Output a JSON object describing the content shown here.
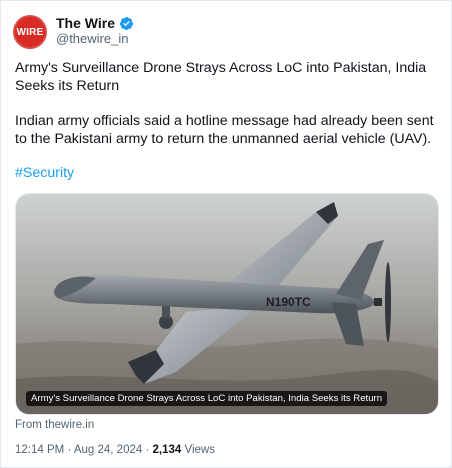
{
  "account": {
    "avatar_text": "WIRE",
    "name": "The Wire",
    "handle": "@thewire_in",
    "brand_color": "#d82b25",
    "verified_color": "#1d9bf0"
  },
  "tweet": {
    "title": "Army's Surveillance Drone Strays Across LoC into Pakistan, India Seeks its Return",
    "body": "Indian army officials said a hotline message had already been sent to the Pakistani army to return the unmanned aerial vehicle (UAV).",
    "hashtag": "#Security"
  },
  "media": {
    "drone_tail_number": "N190TC",
    "caption": "Army's Surveillance Drone Strays Across LoC into Pakistan, India Seeks its Return",
    "source": "From thewire.in"
  },
  "meta": {
    "time": "12:14 PM",
    "separator": "·",
    "date": "Aug 24, 2024",
    "views_count": "2,134",
    "views_label": "Views"
  },
  "icons": {
    "verified": "verified-badge-icon"
  }
}
